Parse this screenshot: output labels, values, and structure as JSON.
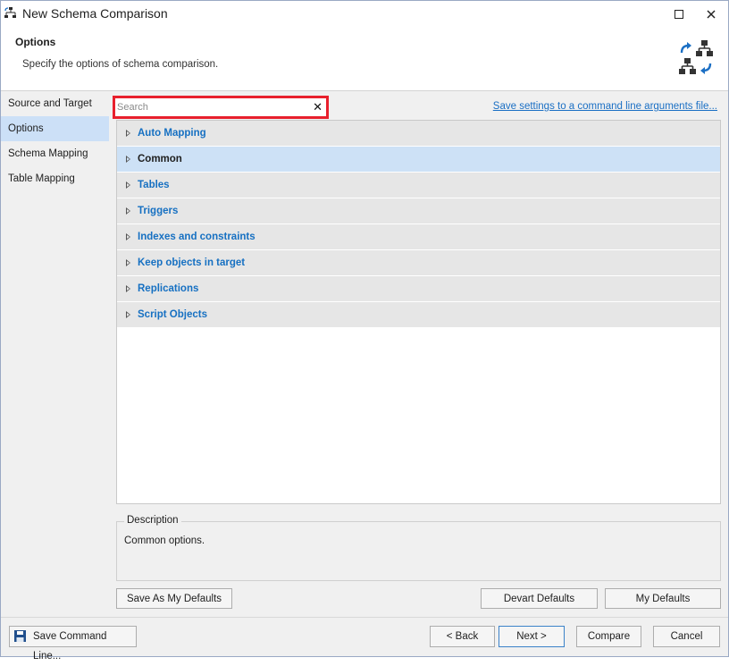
{
  "window": {
    "title": "New Schema Comparison",
    "icon": "schema-compare-icon"
  },
  "header": {
    "title": "Options",
    "subtitle": "Specify the options of schema comparison.",
    "icon": "schema-sync-icon"
  },
  "sidebar": {
    "items": [
      {
        "label": "Source and Target",
        "active": false
      },
      {
        "label": "Options",
        "active": true
      },
      {
        "label": "Schema Mapping",
        "active": false
      },
      {
        "label": "Table Mapping",
        "active": false
      }
    ]
  },
  "search": {
    "value": "",
    "placeholder": "Search",
    "clear_icon": "close-icon"
  },
  "save_link": "Save settings to a command line arguments file...",
  "option_groups": [
    {
      "label": "Auto Mapping",
      "selected": false
    },
    {
      "label": "Common",
      "selected": true
    },
    {
      "label": "Tables",
      "selected": false
    },
    {
      "label": "Triggers",
      "selected": false
    },
    {
      "label": "Indexes and constraints",
      "selected": false
    },
    {
      "label": "Keep objects in target",
      "selected": false
    },
    {
      "label": "Replications",
      "selected": false
    },
    {
      "label": "Script Objects",
      "selected": false
    }
  ],
  "description": {
    "legend": "Description",
    "text": "Common options."
  },
  "buttons": {
    "save_as_defaults": "Save As My Defaults",
    "devart_defaults": "Devart Defaults",
    "my_defaults": "My Defaults",
    "save_command_line": "Save Command Line...",
    "back": "< Back",
    "next": "Next >",
    "compare": "Compare",
    "cancel": "Cancel"
  },
  "colors": {
    "accent_link": "#1a6fc4",
    "selected_row": "#cde1f6",
    "search_highlight": "#e8202d"
  }
}
